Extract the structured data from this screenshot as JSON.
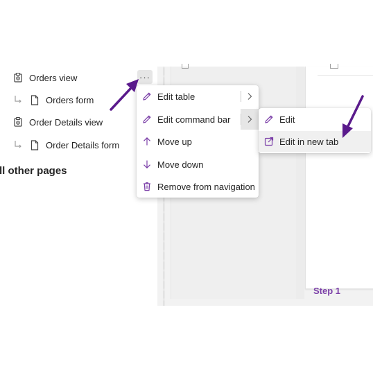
{
  "nav": {
    "items": [
      {
        "label": "Orders view",
        "icon": "view-icon"
      },
      {
        "label": "Orders form",
        "icon": "form-icon"
      },
      {
        "label": "Order Details view",
        "icon": "view-icon"
      },
      {
        "label": "Order Details form",
        "icon": "form-icon"
      }
    ],
    "group_heading": "ll other pages",
    "more_button": "···"
  },
  "context_menu": {
    "items": [
      {
        "label": "Edit table",
        "icon": "pencil-icon",
        "has_submenu": true
      },
      {
        "label": "Edit command bar",
        "icon": "pencil-icon",
        "has_submenu": true
      },
      {
        "label": "Move up",
        "icon": "arrow-up-icon"
      },
      {
        "label": "Move down",
        "icon": "arrow-down-icon"
      },
      {
        "label": "Remove from navigation",
        "icon": "trash-icon"
      }
    ]
  },
  "submenu": {
    "items": [
      {
        "label": "Edit",
        "icon": "pencil-icon"
      },
      {
        "label": "Edit in new tab",
        "icon": "open-in-new-tab-icon"
      }
    ]
  },
  "canvas": {
    "step_label": "Step 1"
  },
  "colors": {
    "annotation_arrow": "#5a1a8c",
    "step_label": "#7b3fa8",
    "icon_default": "#424242",
    "icon_accent": "#7b3fa8"
  }
}
